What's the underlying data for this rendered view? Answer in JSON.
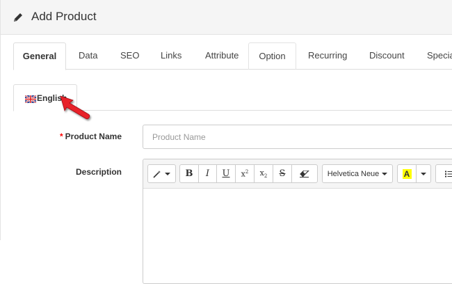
{
  "header": {
    "title": "Add Product",
    "icon": "pencil-icon"
  },
  "tabs": [
    {
      "label": "General",
      "active": true
    },
    {
      "label": "Data",
      "active": false
    },
    {
      "label": "SEO",
      "active": false
    },
    {
      "label": "Links",
      "active": false
    },
    {
      "label": "Attribute",
      "active": false
    },
    {
      "label": "Option",
      "active": false
    },
    {
      "label": "Recurring",
      "active": false
    },
    {
      "label": "Discount",
      "active": false
    },
    {
      "label": "Special",
      "active": false
    }
  ],
  "language_tab": {
    "label": "English",
    "icon": "uk-flag-icon"
  },
  "form": {
    "product_name": {
      "required_mark": "*",
      "label": "Product Name",
      "placeholder": "Product Name",
      "value": ""
    },
    "description": {
      "label": "Description"
    }
  },
  "toolbar": {
    "style_icon": "magic-wand-icon",
    "bold": "B",
    "italic": "I",
    "underline": "U",
    "superscript": "x",
    "subscript": "x",
    "script_mark": "2",
    "strikethrough": "S",
    "eraser_icon": "eraser-icon",
    "font_name": "Helvetica Neue",
    "color_label": "A",
    "list_icon": "unordered-list-icon"
  },
  "colors": {
    "annotation_arrow": "#e8202a",
    "required_asterisk": "#ff0000",
    "color_highlight": "#ffff00"
  }
}
